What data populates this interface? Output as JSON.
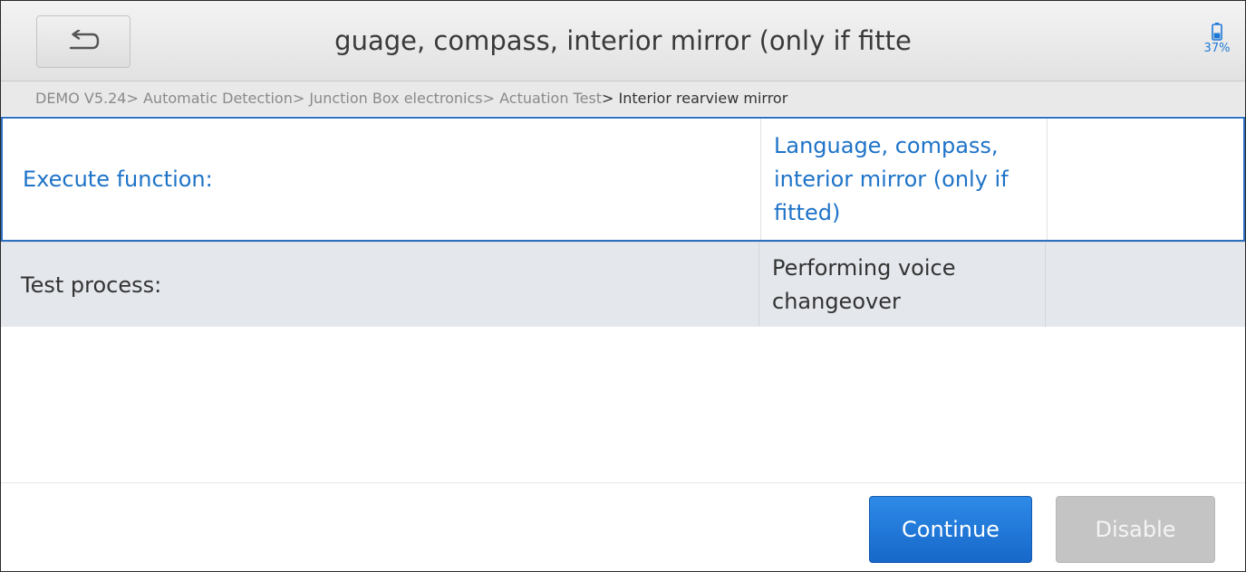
{
  "header": {
    "title": "guage, compass, interior mirror (only if fitte",
    "back_icon": "back-arrow-icon",
    "battery_icon": "battery-icon",
    "battery_percent": "37%"
  },
  "breadcrumb": {
    "path": "DEMO V5.24> Automatic Detection> Junction Box electronics> Actuation Test",
    "current": "> Interior rearview mirror"
  },
  "rows": [
    {
      "label": "Execute function:",
      "value": "Language, compass, interior mirror (only if fitted)",
      "extra": "",
      "selected": true
    },
    {
      "label": "Test process:",
      "value": "Performing voice changeover",
      "extra": "",
      "selected": false
    }
  ],
  "footer": {
    "continue_label": "Continue",
    "disable_label": "Disable"
  },
  "colors": {
    "accent": "#1e73c8",
    "selected_border": "#2c6fc0",
    "continue_button": "#1e78d6",
    "disabled_button": "#c4c4c4",
    "row_alt_background": "#e4e7ec"
  }
}
